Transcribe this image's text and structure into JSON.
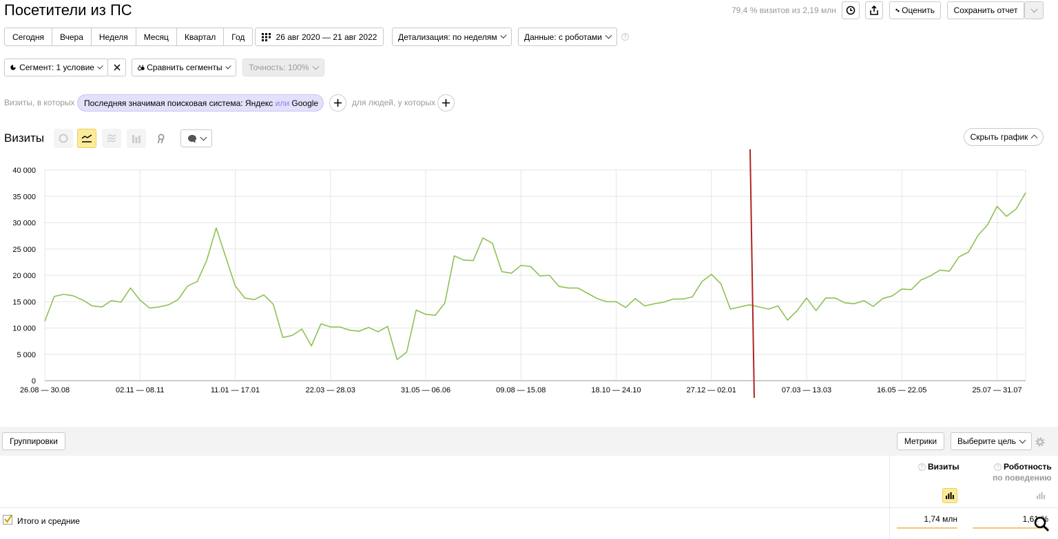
{
  "header": {
    "title": "Посетители из ПС",
    "sample_info": "79,4 % визитов из 2,19 млн",
    "rate_label": "Оценить",
    "save_label": "Сохранить отчет"
  },
  "period_buttons": [
    "Сегодня",
    "Вчера",
    "Неделя",
    "Месяц",
    "Квартал",
    "Год"
  ],
  "date_range": "26 авг 2020 — 21 авг 2022",
  "detail_label": "Детализация: по неделям",
  "data_label": "Данные: с роботами",
  "segment": {
    "label": "Сегмент: 1 условие",
    "compare_label": "Сравнить сегменты",
    "accuracy_label": "Точность: 100%"
  },
  "filter": {
    "visits_prefix": "Визиты, в которых",
    "chip_main": "Последняя значимая поисковая система: Яндекс",
    "chip_or": "или",
    "chip_last": "Google",
    "people_prefix": "для людей, у которых"
  },
  "chart_header": {
    "metric": "Визиты",
    "hide_label": "Скрыть график"
  },
  "chart_data": {
    "type": "line",
    "ylim": [
      0,
      40000
    ],
    "yticks": [
      "0",
      "5 000",
      "10 000",
      "15 000",
      "20 000",
      "25 000",
      "30 000",
      "35 000",
      "40 000"
    ],
    "xtick_labels": [
      "26.08 — 30.08",
      "02.11 — 08.11",
      "11.01 — 17.01",
      "22.03 — 28.03",
      "31.05 — 06.06",
      "09.08 — 15.08",
      "18.10 — 24.10",
      "27.12 — 02.01",
      "07.03 — 13.03",
      "16.05 — 22.05",
      "25.07 — 31.07"
    ],
    "color": "#8cc152",
    "annotation_color": "#b22222",
    "grid": true,
    "values": [
      11300,
      16000,
      16400,
      16100,
      15300,
      14200,
      14000,
      15200,
      14900,
      17600,
      15300,
      13800,
      14000,
      14400,
      15400,
      18000,
      18800,
      22800,
      29000,
      23500,
      18000,
      15700,
      15400,
      16300,
      14500,
      8200,
      8600,
      9800,
      6600,
      10800,
      10200,
      10200,
      9600,
      9400,
      10100,
      9300,
      10300,
      4000,
      5400,
      13400,
      12600,
      12400,
      14700,
      23700,
      22900,
      22800,
      27100,
      26100,
      20700,
      20400,
      21900,
      21700,
      19900,
      20000,
      17900,
      17600,
      17600,
      16600,
      15600,
      15000,
      15000,
      13900,
      15600,
      14200,
      14600,
      14900,
      15500,
      15500,
      15900,
      18800,
      20200,
      18400,
      13600,
      14000,
      14400,
      14000,
      13600,
      14200,
      11500,
      13300,
      15700,
      13300,
      15700,
      15700,
      14800,
      14600,
      15200,
      14100,
      15600,
      16100,
      17400,
      17300,
      19100,
      19900,
      21000,
      20800,
      23500,
      24400,
      27600,
      29600,
      33100,
      31200,
      32600,
      35700
    ]
  },
  "table": {
    "groupings_label": "Группировки",
    "metrics_label": "Метрики",
    "goal_label": "Выберите цель",
    "col_visits": "Визиты",
    "col_robot": "Роботность",
    "col_robot_sub": "по поведению",
    "totals_label": "Итого и средние",
    "total_visits": "1,74 млн",
    "total_robot": "1,61 %"
  }
}
